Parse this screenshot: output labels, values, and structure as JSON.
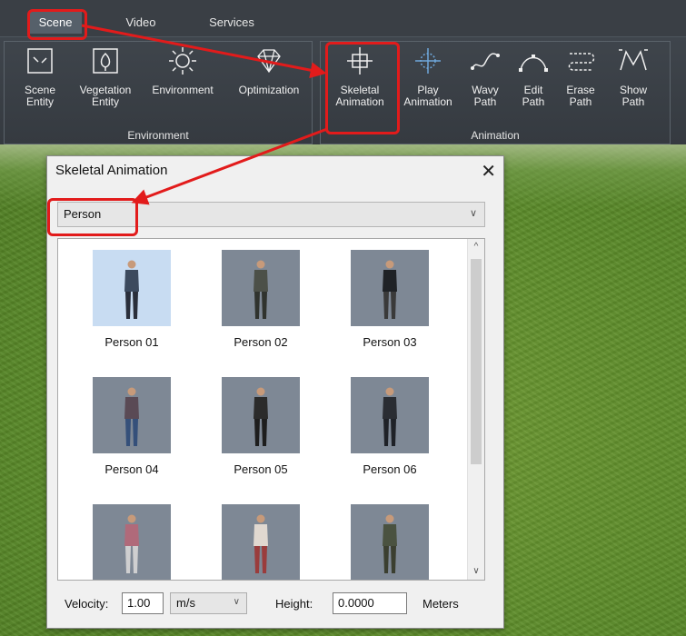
{
  "tabs": [
    {
      "label": "Scene",
      "active": true
    },
    {
      "label": "Video",
      "active": false
    },
    {
      "label": "Services",
      "active": false
    }
  ],
  "ribbon": {
    "environment_group": {
      "label": "Environment",
      "buttons": [
        {
          "line1": "Scene",
          "line2": "Entity",
          "icon": "scene-entity-icon"
        },
        {
          "line1": "Vegetation",
          "line2": "Entity",
          "icon": "vegetation-icon"
        },
        {
          "line1": "Environment",
          "line2": "",
          "icon": "sun-icon"
        },
        {
          "line1": "Optimization",
          "line2": "",
          "icon": "diamond-icon"
        }
      ]
    },
    "animation_group": {
      "label": "Animation",
      "buttons": [
        {
          "line1": "Skeletal",
          "line2": "Animation",
          "icon": "skeletal-animation-icon"
        },
        {
          "line1": "Play",
          "line2": "Animation",
          "icon": "play-animation-icon"
        },
        {
          "line1": "Wavy",
          "line2": "Path",
          "icon": "wavy-path-icon"
        },
        {
          "line1": "Edit",
          "line2": "Path",
          "icon": "edit-path-icon"
        },
        {
          "line1": "Erase",
          "line2": "Path",
          "icon": "erase-path-icon"
        },
        {
          "line1": "Show",
          "line2": "Path",
          "icon": "show-path-icon"
        }
      ]
    }
  },
  "dialog": {
    "title": "Skeletal Animation",
    "close_glyph": "✕",
    "category": "Person",
    "items": [
      "Person 01",
      "Person 02",
      "Person 03",
      "Person 04",
      "Person 05",
      "Person 06",
      "",
      "",
      ""
    ],
    "velocity_label": "Velocity:",
    "velocity_value": "1.00",
    "velocity_unit": "m/s",
    "height_label": "Height:",
    "height_value": "0.0000",
    "height_unit": "Meters"
  },
  "colors": {
    "annotation": "#e21b1b",
    "ribbon": "#3f454c",
    "selected_thumb": "#c8dcf2"
  }
}
